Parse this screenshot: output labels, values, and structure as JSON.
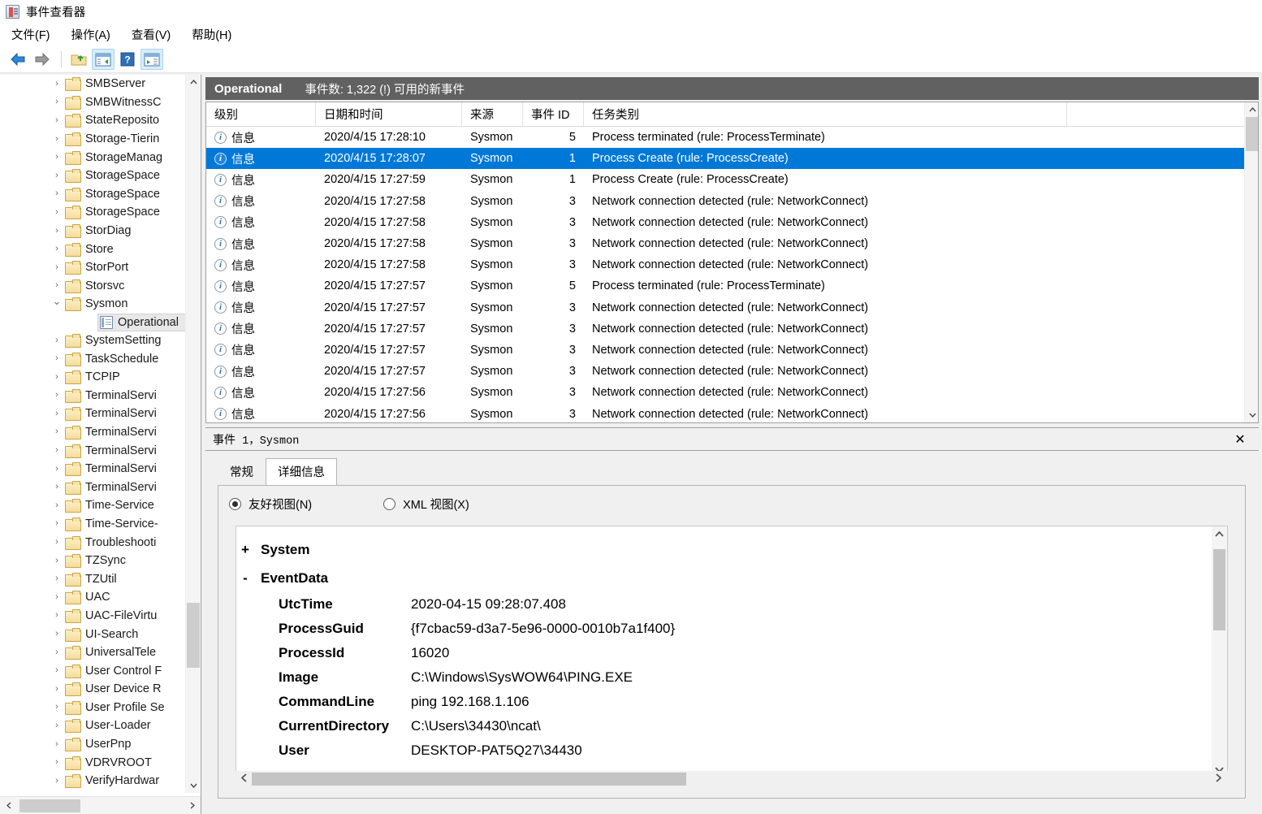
{
  "window": {
    "title": "事件查看器",
    "icon": "event-viewer-icon"
  },
  "menubar": {
    "items": [
      {
        "label": "文件(F)",
        "name": "menu-file"
      },
      {
        "label": "操作(A)",
        "name": "menu-action"
      },
      {
        "label": "查看(V)",
        "name": "menu-view"
      },
      {
        "label": "帮助(H)",
        "name": "menu-help"
      }
    ]
  },
  "toolbar": {
    "buttons": [
      {
        "name": "back-arrow-icon",
        "glyph": "←"
      },
      {
        "name": "forward-arrow-icon",
        "glyph": "→"
      },
      {
        "name": "up-folder-icon",
        "glyph": "↑"
      },
      {
        "name": "show-hide-console-tree-icon",
        "glyph": "▤"
      },
      {
        "name": "help-icon",
        "glyph": "?"
      },
      {
        "name": "show-hide-action-pane-icon",
        "glyph": "▶"
      }
    ]
  },
  "tree": {
    "items": [
      {
        "label": "SMBServer",
        "icon": "folder-icon",
        "expanded": false
      },
      {
        "label": "SMBWitnessC",
        "icon": "folder-icon",
        "expanded": false
      },
      {
        "label": "StateReposito",
        "icon": "folder-icon",
        "expanded": false
      },
      {
        "label": "Storage-Tierin",
        "icon": "folder-icon",
        "expanded": false
      },
      {
        "label": "StorageManag",
        "icon": "folder-icon",
        "expanded": false
      },
      {
        "label": "StorageSpace",
        "icon": "folder-icon",
        "expanded": false
      },
      {
        "label": "StorageSpace",
        "icon": "folder-icon",
        "expanded": false
      },
      {
        "label": "StorageSpace",
        "icon": "folder-icon",
        "expanded": false
      },
      {
        "label": "StorDiag",
        "icon": "folder-icon",
        "expanded": false
      },
      {
        "label": "Store",
        "icon": "folder-icon",
        "expanded": false
      },
      {
        "label": "StorPort",
        "icon": "folder-icon",
        "expanded": false
      },
      {
        "label": "Storsvc",
        "icon": "folder-icon",
        "expanded": false
      },
      {
        "label": "Sysmon",
        "icon": "folder-icon",
        "expanded": true
      },
      {
        "label": "Operational",
        "icon": "log-icon",
        "child": true,
        "selected": true
      },
      {
        "label": "SystemSetting",
        "icon": "folder-icon",
        "expanded": false
      },
      {
        "label": "TaskSchedule",
        "icon": "folder-icon",
        "expanded": false
      },
      {
        "label": "TCPIP",
        "icon": "folder-icon",
        "expanded": false
      },
      {
        "label": "TerminalServi",
        "icon": "folder-icon",
        "expanded": false
      },
      {
        "label": "TerminalServi",
        "icon": "folder-icon",
        "expanded": false
      },
      {
        "label": "TerminalServi",
        "icon": "folder-icon",
        "expanded": false
      },
      {
        "label": "TerminalServi",
        "icon": "folder-icon",
        "expanded": false
      },
      {
        "label": "TerminalServi",
        "icon": "folder-icon",
        "expanded": false
      },
      {
        "label": "TerminalServi",
        "icon": "folder-icon",
        "expanded": false
      },
      {
        "label": "Time-Service",
        "icon": "folder-icon",
        "expanded": false
      },
      {
        "label": "Time-Service-",
        "icon": "folder-icon",
        "expanded": false
      },
      {
        "label": "Troubleshooti",
        "icon": "folder-icon",
        "expanded": false
      },
      {
        "label": "TZSync",
        "icon": "folder-icon",
        "expanded": false
      },
      {
        "label": "TZUtil",
        "icon": "folder-icon",
        "expanded": false
      },
      {
        "label": "UAC",
        "icon": "folder-icon",
        "expanded": false
      },
      {
        "label": "UAC-FileVirtu",
        "icon": "folder-icon",
        "expanded": false
      },
      {
        "label": "UI-Search",
        "icon": "folder-icon",
        "expanded": false
      },
      {
        "label": "UniversalTele",
        "icon": "folder-icon",
        "expanded": false
      },
      {
        "label": "User Control F",
        "icon": "folder-icon",
        "expanded": false
      },
      {
        "label": "User Device R",
        "icon": "folder-icon",
        "expanded": false
      },
      {
        "label": "User Profile Se",
        "icon": "folder-icon",
        "expanded": false
      },
      {
        "label": "User-Loader",
        "icon": "folder-icon",
        "expanded": false
      },
      {
        "label": "UserPnp",
        "icon": "folder-icon",
        "expanded": false
      },
      {
        "label": "VDRVROOT",
        "icon": "folder-icon",
        "expanded": false
      },
      {
        "label": "VerifyHardwar",
        "icon": "folder-icon",
        "expanded": false
      }
    ]
  },
  "event_list": {
    "header_title": "Operational",
    "header_sub": "事件数: 1,322 (!) 可用的新事件",
    "columns": [
      "级别",
      "日期和时间",
      "来源",
      "事件 ID",
      "任务类别"
    ],
    "rows": [
      {
        "level": "信息",
        "datetime": "2020/4/15 17:28:10",
        "source": "Sysmon",
        "event_id": "5",
        "task": "Process terminated (rule: ProcessTerminate)",
        "selected": false
      },
      {
        "level": "信息",
        "datetime": "2020/4/15 17:28:07",
        "source": "Sysmon",
        "event_id": "1",
        "task": "Process Create (rule: ProcessCreate)",
        "selected": true
      },
      {
        "level": "信息",
        "datetime": "2020/4/15 17:27:59",
        "source": "Sysmon",
        "event_id": "1",
        "task": "Process Create (rule: ProcessCreate)",
        "selected": false
      },
      {
        "level": "信息",
        "datetime": "2020/4/15 17:27:58",
        "source": "Sysmon",
        "event_id": "3",
        "task": "Network connection detected (rule: NetworkConnect)",
        "selected": false
      },
      {
        "level": "信息",
        "datetime": "2020/4/15 17:27:58",
        "source": "Sysmon",
        "event_id": "3",
        "task": "Network connection detected (rule: NetworkConnect)",
        "selected": false
      },
      {
        "level": "信息",
        "datetime": "2020/4/15 17:27:58",
        "source": "Sysmon",
        "event_id": "3",
        "task": "Network connection detected (rule: NetworkConnect)",
        "selected": false
      },
      {
        "level": "信息",
        "datetime": "2020/4/15 17:27:58",
        "source": "Sysmon",
        "event_id": "3",
        "task": "Network connection detected (rule: NetworkConnect)",
        "selected": false
      },
      {
        "level": "信息",
        "datetime": "2020/4/15 17:27:57",
        "source": "Sysmon",
        "event_id": "5",
        "task": "Process terminated (rule: ProcessTerminate)",
        "selected": false
      },
      {
        "level": "信息",
        "datetime": "2020/4/15 17:27:57",
        "source": "Sysmon",
        "event_id": "3",
        "task": "Network connection detected (rule: NetworkConnect)",
        "selected": false
      },
      {
        "level": "信息",
        "datetime": "2020/4/15 17:27:57",
        "source": "Sysmon",
        "event_id": "3",
        "task": "Network connection detected (rule: NetworkConnect)",
        "selected": false
      },
      {
        "level": "信息",
        "datetime": "2020/4/15 17:27:57",
        "source": "Sysmon",
        "event_id": "3",
        "task": "Network connection detected (rule: NetworkConnect)",
        "selected": false
      },
      {
        "level": "信息",
        "datetime": "2020/4/15 17:27:57",
        "source": "Sysmon",
        "event_id": "3",
        "task": "Network connection detected (rule: NetworkConnect)",
        "selected": false
      },
      {
        "level": "信息",
        "datetime": "2020/4/15 17:27:56",
        "source": "Sysmon",
        "event_id": "3",
        "task": "Network connection detected (rule: NetworkConnect)",
        "selected": false
      },
      {
        "level": "信息",
        "datetime": "2020/4/15 17:27:56",
        "source": "Sysmon",
        "event_id": "3",
        "task": "Network connection detected (rule: NetworkConnect)",
        "selected": false
      }
    ]
  },
  "detail": {
    "title_prefix": "事件",
    "title_rest": " 1，Sysmon",
    "close_label": "✕",
    "tabs": [
      {
        "label": "常规",
        "active": false
      },
      {
        "label": "详细信息",
        "active": true
      }
    ],
    "radios": [
      {
        "label": "友好视图(N)",
        "selected": true
      },
      {
        "label": "XML 视图(X)",
        "selected": false
      }
    ],
    "nodes": [
      {
        "sign": "+",
        "name": "System"
      },
      {
        "sign": "-",
        "name": "EventData"
      }
    ],
    "event_data": [
      {
        "key": "UtcTime",
        "value": "2020-04-15 09:28:07.408"
      },
      {
        "key": "ProcessGuid",
        "value": "{f7cbac59-d3a7-5e96-0000-0010b7a1f400}"
      },
      {
        "key": "ProcessId",
        "value": "16020"
      },
      {
        "key": "Image",
        "value": "C:\\Windows\\SysWOW64\\PING.EXE"
      },
      {
        "key": "CommandLine",
        "value": "ping 192.168.1.106"
      },
      {
        "key": "CurrentDirectory",
        "value": "C:\\Users\\34430\\ncat\\"
      },
      {
        "key": "User",
        "value": "DESKTOP-PAT5Q27\\34430"
      }
    ]
  },
  "colors": {
    "selection_blue": "#0078d7",
    "header_band_gray": "#616161",
    "folder_yellow": "#f4dc9a"
  }
}
